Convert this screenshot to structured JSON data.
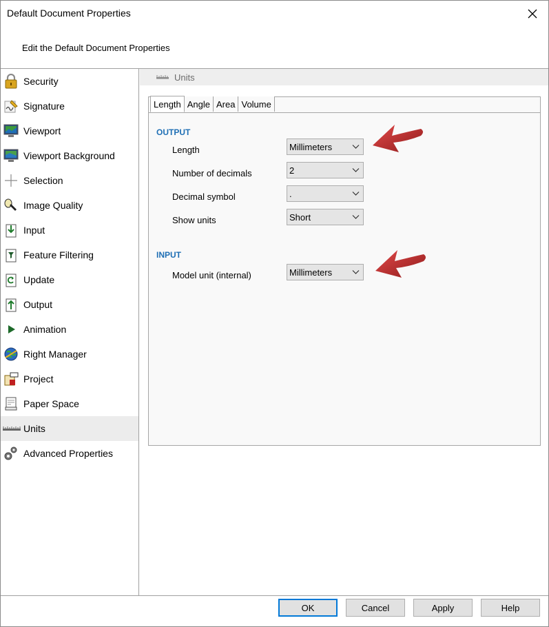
{
  "window": {
    "title": "Default Document Properties",
    "subtitle": "Edit the Default Document Properties"
  },
  "sidebar": {
    "items": [
      {
        "label": "Security",
        "icon": "padlock-icon"
      },
      {
        "label": "Signature",
        "icon": "signature-icon"
      },
      {
        "label": "Viewport",
        "icon": "monitor-icon"
      },
      {
        "label": "Viewport Background",
        "icon": "monitor-background-icon"
      },
      {
        "label": "Selection",
        "icon": "crosshair-icon"
      },
      {
        "label": "Image Quality",
        "icon": "flashlight-icon"
      },
      {
        "label": "Input",
        "icon": "document-input-icon"
      },
      {
        "label": "Feature Filtering",
        "icon": "document-filter-icon"
      },
      {
        "label": "Update",
        "icon": "document-update-icon"
      },
      {
        "label": "Output",
        "icon": "document-output-icon"
      },
      {
        "label": "Animation",
        "icon": "play-icon"
      },
      {
        "label": "Right Manager",
        "icon": "globe-icon"
      },
      {
        "label": "Project",
        "icon": "project-box-icon"
      },
      {
        "label": "Paper Space",
        "icon": "paper-sheet-icon"
      },
      {
        "label": "Units",
        "icon": "ruler-icon"
      },
      {
        "label": "Advanced Properties",
        "icon": "gears-icon"
      }
    ],
    "selected_index": 14
  },
  "content": {
    "section_title": "Units",
    "tabs": [
      "Length",
      "Angle",
      "Area",
      "Volume"
    ],
    "active_tab": "Length",
    "output": {
      "heading": "OUTPUT",
      "length_label": "Length",
      "length_value": "Millimeters",
      "decimals_label": "Number of decimals",
      "decimals_value": "2",
      "decimal_symbol_label": "Decimal symbol",
      "decimal_symbol_value": ".",
      "show_units_label": "Show units",
      "show_units_value": "Short"
    },
    "input": {
      "heading": "INPUT",
      "model_unit_label": "Model unit (internal)",
      "model_unit_value": "Millimeters"
    }
  },
  "footer": {
    "ok": "OK",
    "cancel": "Cancel",
    "apply": "Apply",
    "help": "Help"
  },
  "colors": {
    "accent_heading": "#1f6fb5",
    "default_button_border": "#0078d7",
    "annotation_arrow": "#b31a1a"
  }
}
